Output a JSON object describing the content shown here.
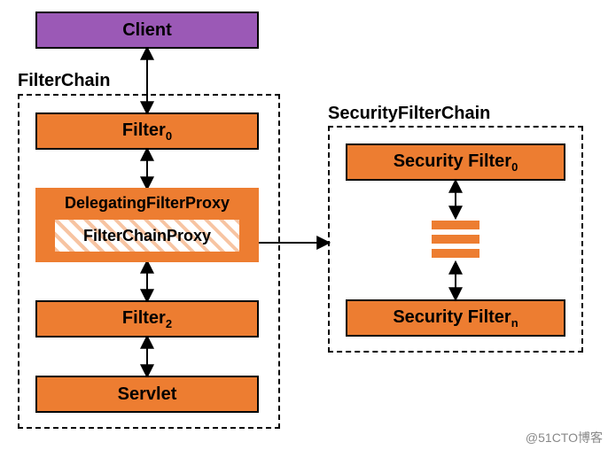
{
  "client": {
    "label": "Client"
  },
  "filterchain": {
    "label": "FilterChain",
    "filter0": "Filter",
    "filter0_sub": "0",
    "filter2": "Filter",
    "filter2_sub": "2",
    "servlet": "Servlet",
    "delegating_title": "DelegatingFilterProxy",
    "inner": "FilterChainProxy"
  },
  "security": {
    "label": "SecurityFilterChain",
    "filter0": "Security Filter",
    "filter0_sub": "0",
    "filtern": "Security Filter",
    "filtern_sub": "n"
  },
  "watermark": "@51CTO博客",
  "chart_data": {
    "type": "diagram",
    "nodes": [
      {
        "id": "client",
        "label": "Client",
        "container": null
      },
      {
        "id": "filter0",
        "label": "Filter0",
        "container": "FilterChain"
      },
      {
        "id": "delegatingFilterProxy",
        "label": "DelegatingFilterProxy",
        "container": "FilterChain",
        "children": [
          "filterChainProxy"
        ]
      },
      {
        "id": "filterChainProxy",
        "label": "FilterChainProxy",
        "container": "delegatingFilterProxy"
      },
      {
        "id": "filter2",
        "label": "Filter2",
        "container": "FilterChain"
      },
      {
        "id": "servlet",
        "label": "Servlet",
        "container": "FilterChain"
      },
      {
        "id": "secFilter0",
        "label": "Security Filter0",
        "container": "SecurityFilterChain"
      },
      {
        "id": "secStack",
        "label": "(more filters)",
        "container": "SecurityFilterChain"
      },
      {
        "id": "secFilterN",
        "label": "Security FilterN",
        "container": "SecurityFilterChain"
      }
    ],
    "containers": [
      {
        "id": "FilterChain",
        "label": "FilterChain"
      },
      {
        "id": "SecurityFilterChain",
        "label": "SecurityFilterChain"
      }
    ],
    "edges": [
      {
        "from": "client",
        "to": "filter0",
        "dir": "both"
      },
      {
        "from": "filter0",
        "to": "delegatingFilterProxy",
        "dir": "both"
      },
      {
        "from": "delegatingFilterProxy",
        "to": "filter2",
        "dir": "both"
      },
      {
        "from": "filter2",
        "to": "servlet",
        "dir": "both"
      },
      {
        "from": "filterChainProxy",
        "to": "SecurityFilterChain",
        "dir": "forward"
      },
      {
        "from": "secFilter0",
        "to": "secStack",
        "dir": "both"
      },
      {
        "from": "secStack",
        "to": "secFilterN",
        "dir": "both"
      }
    ]
  }
}
